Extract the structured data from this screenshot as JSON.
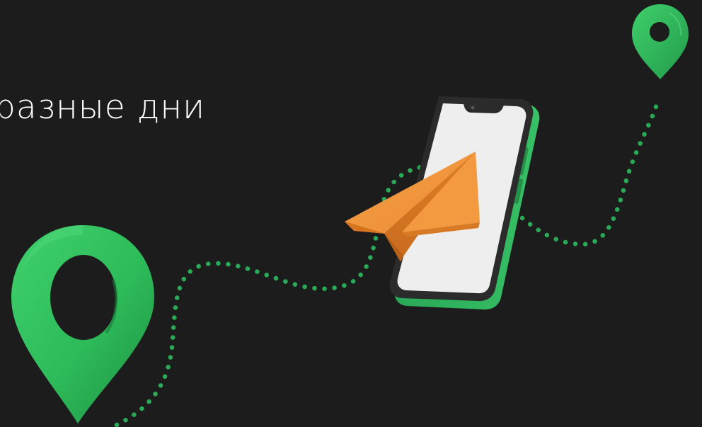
{
  "headline": {
    "text": "разные дни"
  },
  "colors": {
    "background": "#1c1c1c",
    "pin_green": "#2dbb59",
    "route_dots": "#2aa957",
    "phone_body": "#2aa957",
    "phone_frame": "#2b2b2b",
    "phone_screen": "#efeeee",
    "paper_plane": "#f0923a",
    "headline": "#ffffff"
  },
  "icons": {
    "large_pin": "location-pin-icon",
    "small_pin": "location-pin-icon",
    "plane": "paper-plane-icon",
    "phone": "smartphone-icon"
  }
}
